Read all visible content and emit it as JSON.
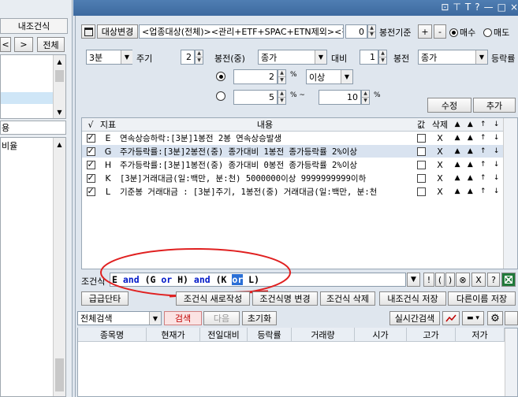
{
  "left_panel": {
    "title": "내조건식",
    "nav_prev": "<",
    "nav_next": ">",
    "all_btn": "전체",
    "field1": "용",
    "list_item": "비율"
  },
  "toolbar": {
    "target_change": "대상변경",
    "target_text": "<업종대상(전체)><관리+ETF+SPAC+ETN제외><전체",
    "base_value": "0",
    "base_label": "봉전기준",
    "plus": "+",
    "minus": "-",
    "radio_buy": "매수",
    "radio_sell": "매도"
  },
  "params": {
    "period_value": "3분",
    "period_label": "주기",
    "n_value": "2",
    "n_unit": "봉전(중)",
    "price_a": "종가",
    "vs_label": "대비",
    "m_value": "1",
    "m_unit": "봉전",
    "price_b": "종가",
    "rate_label": "등락률",
    "pct1_value": "2",
    "pct_unit": "%",
    "cond_value": "이상",
    "pct2_value": "5",
    "tilde": "%  ~",
    "pct3_value": "10",
    "edit_btn": "수정",
    "add_btn": "추가"
  },
  "table": {
    "headers": [
      "√",
      "지표",
      "내용",
      "값",
      "삭제"
    ],
    "rows": [
      {
        "id": "E",
        "text": "연속상승하락:[3분]1봉전 2봉 연속상승발생",
        "del": "X",
        "selected": false
      },
      {
        "id": "G",
        "text": "주가등락률:[3분]2봉전(중) 종가대비 1봉전 종가등락률 2%이상",
        "del": "X",
        "selected": true
      },
      {
        "id": "H",
        "text": "주가등락률:[3분]1봉전(중) 종가대비 0봉전 종가등락률 2%이상",
        "del": "X",
        "selected": false
      },
      {
        "id": "K",
        "text": "[3분]거래대금(일:백만, 분:천) 5000000이상 9999999999이하",
        "del": "X",
        "selected": false
      },
      {
        "id": "L",
        "text": "기준봉 거래대금 : [3분]주기, 1봉전(중) 거래대금(일:백만, 분:천",
        "del": "X",
        "selected": false
      }
    ]
  },
  "condition": {
    "label": "조건식",
    "parts": [
      "E",
      " and ",
      "(G",
      " or ",
      "H)",
      " and ",
      "(K ",
      "or",
      " L)"
    ],
    "btns": [
      "!",
      "(",
      ")",
      "⊗",
      "X",
      "?"
    ]
  },
  "actions": {
    "quick": "급급단타",
    "new": "조건식 새로작성",
    "rename": "조건식명 변경",
    "delete": "조건식 삭제",
    "save": "내조건식 저장",
    "save_as": "다른이름 저장"
  },
  "search": {
    "scope": "전체검색",
    "search_btn": "검색",
    "next_btn": "다음",
    "reset_btn": "초기화",
    "realtime_btn": "실시간검색"
  },
  "results": {
    "columns": [
      "종목명",
      "현재가",
      "전일대비",
      "등락률",
      "거래량",
      "시가",
      "고가",
      "저가"
    ]
  },
  "window": {
    "title_icons": [
      "⊡",
      "⊤",
      "T",
      "?",
      "—",
      "□",
      "×"
    ]
  }
}
